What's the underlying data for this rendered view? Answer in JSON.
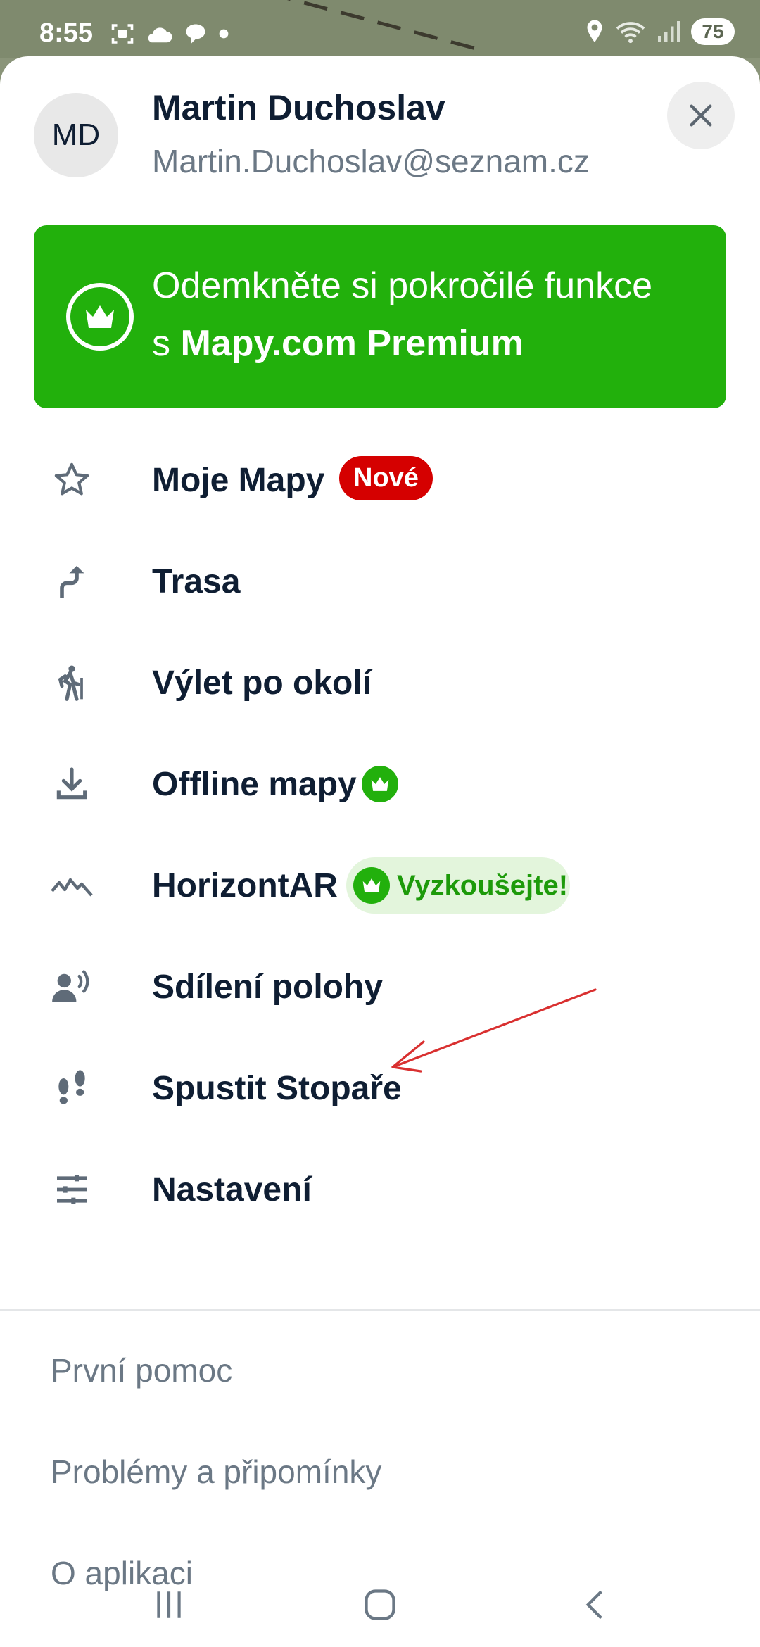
{
  "status_bar": {
    "time": "8:55",
    "battery": "75",
    "icons_left": [
      "screenshot-icon",
      "cloud-icon",
      "chat-icon",
      "dot-icon"
    ],
    "icons_right": [
      "location-icon",
      "wifi-icon",
      "signal-icon"
    ]
  },
  "user": {
    "initials": "MD",
    "name": "Martin Duchoslav",
    "email": "Martin.Duchoslav@seznam.cz"
  },
  "premium": {
    "line1": "Odemkněte si pokročilé funkce",
    "line2_prefix": "s ",
    "line2_bold": "Mapy.com Premium"
  },
  "menu": {
    "items": [
      {
        "label": "Moje Mapy",
        "icon": "star-icon",
        "badge": "Nové"
      },
      {
        "label": "Trasa",
        "icon": "route-icon"
      },
      {
        "label": "Výlet po okolí",
        "icon": "hiker-icon"
      },
      {
        "label": "Offline mapy",
        "icon": "download-icon"
      },
      {
        "label": "HorizontAR",
        "icon": "mountains-icon",
        "badge": "Vyzkoušejte!"
      },
      {
        "label": "Sdílení polohy",
        "icon": "share-location-icon"
      },
      {
        "label": "Spustit Stopaře",
        "icon": "footprints-icon"
      },
      {
        "label": "Nastavení",
        "icon": "settings-sliders-icon"
      }
    ]
  },
  "secondary": {
    "items": [
      "První pomoc",
      "Problémy a připomínky",
      "O aplikaci"
    ]
  },
  "colors": {
    "brand_green": "#22b00c",
    "badge_red": "#d50000",
    "text_dark": "#0f1e33",
    "text_muted": "#6b7885"
  }
}
